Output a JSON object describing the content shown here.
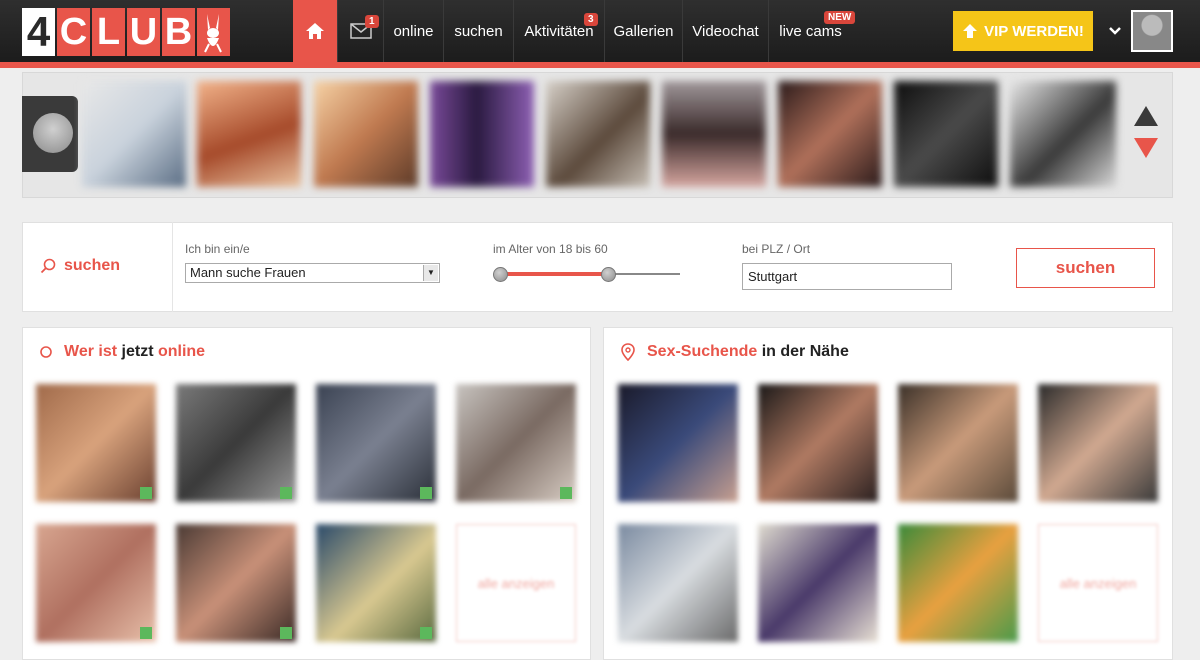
{
  "brand": {
    "logo_letters": [
      "4",
      "C",
      "L",
      "U",
      "B"
    ]
  },
  "colors": {
    "accent": "#e8554a",
    "nav_bg": "#222222",
    "vip": "#f5c518",
    "online": "#5cb85c"
  },
  "nav": {
    "home_icon": "home-icon",
    "mail_icon": "envelope-icon",
    "mail_badge": "1",
    "online": "online",
    "suchen": "suchen",
    "aktivitaeten": "Aktivitäten",
    "aktivitaeten_badge": "3",
    "galerien": "Gallerien",
    "videochat": "Videochat",
    "live_cams": "live cams",
    "live_cams_badge": "NEW",
    "vip_label": "VIP WERDEN!",
    "vip_icon": "arrow-up-icon",
    "menu_icon": "chevron-down-icon"
  },
  "search": {
    "title": "suchen",
    "label_gender": "Ich bin ein/e",
    "gender_value": "Mann suche Frauen",
    "label_age": "im Alter von 18 bis 60",
    "age_min": 18,
    "age_max": 60,
    "label_plz": "bei PLZ / Ort",
    "plz_value": "Stuttgart",
    "button": "suchen"
  },
  "panels": {
    "online": {
      "title_a": "Wer ist",
      "title_b": "jetzt",
      "title_c": "online",
      "show_all": "alle anzeigen"
    },
    "nearby": {
      "title_a": "Sex-Suchende",
      "title_b": "in der Nähe",
      "show_all": "alle anzeigen"
    }
  }
}
